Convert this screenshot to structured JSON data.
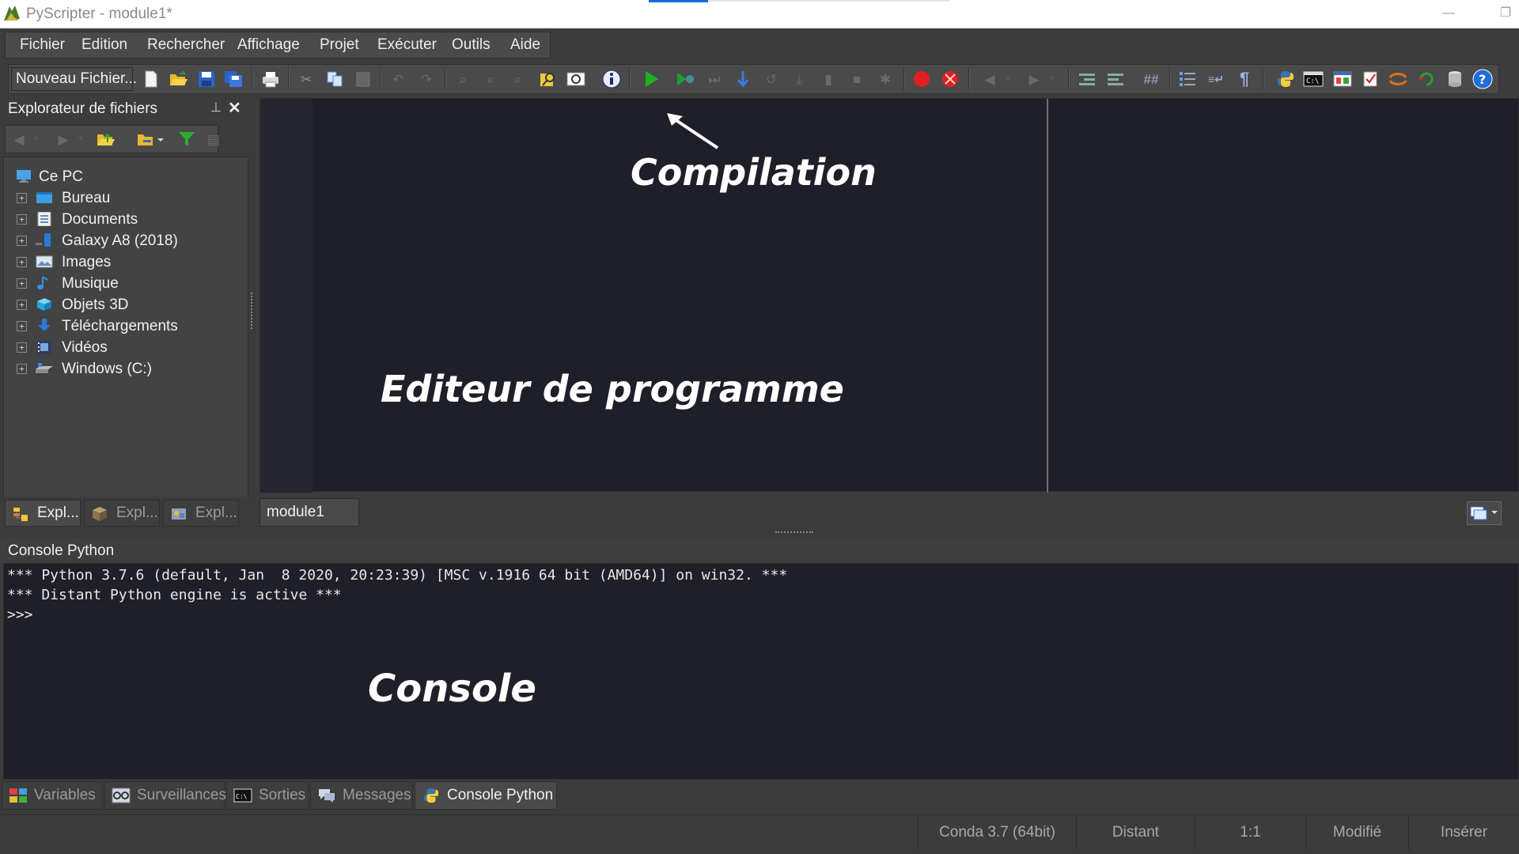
{
  "window": {
    "title": "PyScripter - module1*",
    "minimize": "—",
    "restore": "❐"
  },
  "menu": {
    "items": [
      "Fichier",
      "Edition",
      "Rechercher",
      "Affichage",
      "Projet",
      "Exécuter",
      "Outils",
      "Aide"
    ]
  },
  "toolbar": {
    "new_file_label": "Nouveau Fichier...",
    "icons": [
      "new-file",
      "open-file",
      "save",
      "save-all",
      "print",
      "cut",
      "copy",
      "paste",
      "undo",
      "redo",
      "find",
      "find-next",
      "replace",
      "find-in-files",
      "toggle-view",
      "info",
      "run",
      "debug",
      "step-over",
      "step-into",
      "step-out",
      "run-to-cursor",
      "pause",
      "abort",
      "toggle-breakpoint",
      "clear-breakpoints",
      "back",
      "forward",
      "indent",
      "dedent",
      "comment",
      "outline",
      "word-wrap",
      "show-special-chars",
      "python",
      "command-prompt",
      "layout",
      "checkbox",
      "sync",
      "refresh",
      "database",
      "help"
    ]
  },
  "explorer": {
    "title": "Explorateur de fichiers",
    "tree": [
      {
        "label": "Ce PC",
        "icon": "computer-icon",
        "root": true
      },
      {
        "label": "Bureau",
        "icon": "desktop-folder-icon"
      },
      {
        "label": "Documents",
        "icon": "documents-folder-icon"
      },
      {
        "label": "Galaxy A8 (2018)",
        "icon": "phone-device-icon"
      },
      {
        "label": "Images",
        "icon": "images-folder-icon"
      },
      {
        "label": "Musique",
        "icon": "music-folder-icon"
      },
      {
        "label": "Objets 3D",
        "icon": "3d-objects-folder-icon"
      },
      {
        "label": "Téléchargements",
        "icon": "downloads-folder-icon"
      },
      {
        "label": "Vidéos",
        "icon": "videos-folder-icon"
      },
      {
        "label": "Windows (C:)",
        "icon": "drive-icon"
      }
    ],
    "tabs": [
      "Expl...",
      "Expl...",
      "Expl..."
    ]
  },
  "editor": {
    "annotation_compilation": "Compilation",
    "annotation_editor": "Editeur de programme",
    "tab_label": "module1"
  },
  "console": {
    "title": "Console Python",
    "lines": [
      "*** Python 3.7.6 (default, Jan  8 2020, 20:23:39) [MSC v.1916 64 bit (AMD64)] on win32. ***",
      "*** Distant Python engine is active ***",
      ">>>"
    ],
    "annotation": "Console"
  },
  "bottom_tabs": [
    "Variables",
    "Surveillances",
    "Sorties",
    "Messages",
    "Console Python"
  ],
  "status": {
    "interpreter": "Conda 3.7 (64bit)",
    "engine": "Distant",
    "position": "1:1",
    "modified": "Modifié",
    "mode": "Insérer"
  },
  "colors": {
    "run_green": "#1db31d",
    "breakpoint_red": "#e02020",
    "help_blue": "#1e6fd9",
    "editor_bg": "#1f1f29"
  }
}
